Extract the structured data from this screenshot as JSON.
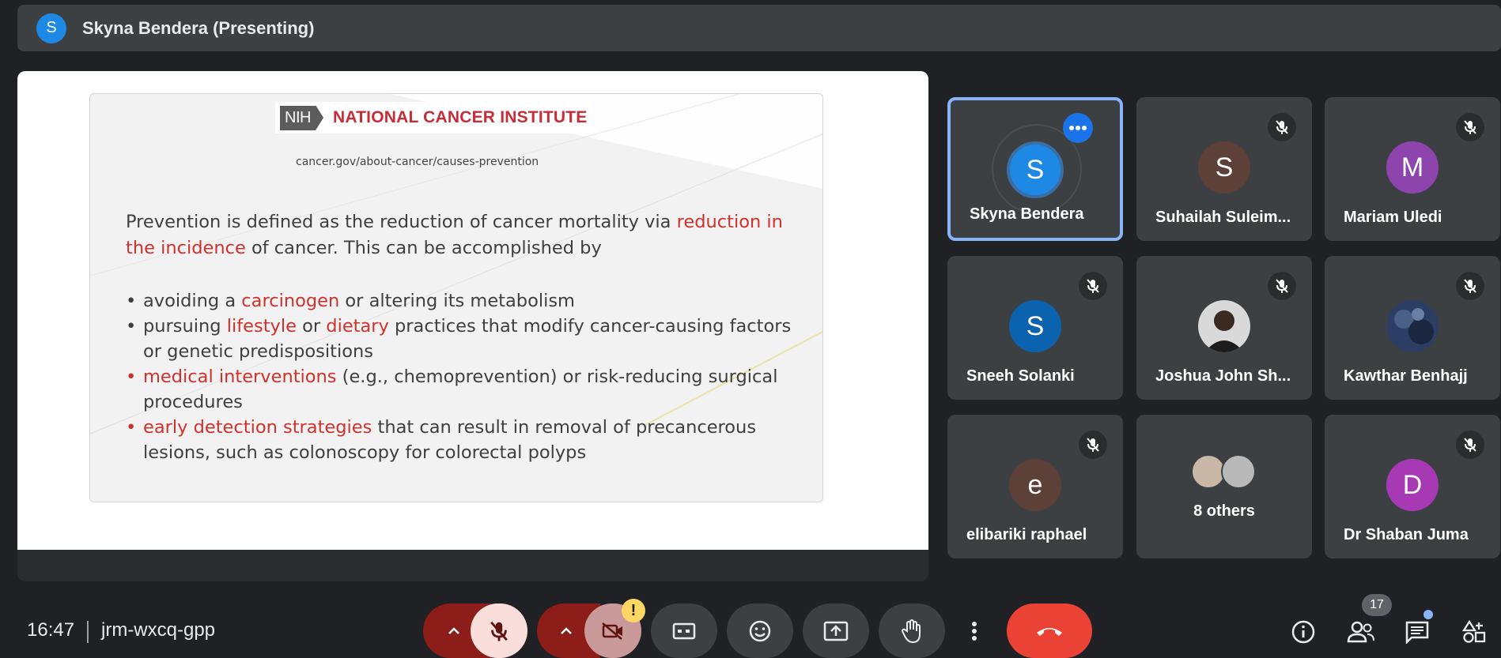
{
  "presenter_bar": {
    "avatar_letter": "S",
    "label": "Skyna Bendera (Presenting)"
  },
  "slide": {
    "logo_box": "NIH",
    "logo_title": "NATIONAL CANCER INSTITUTE",
    "url": "cancer.gov/about-cancer/causes-prevention",
    "para_1": "Prevention is defined as the reduction of cancer mortality via ",
    "para_red": "reduction in the incidence",
    "para_2": " of cancer. This can be accomplished by",
    "b1_a": "avoiding a ",
    "b1_red": "carcinogen",
    "b1_b": " or altering its metabolism",
    "b2_a": "pursuing ",
    "b2_red1": "lifestyle",
    "b2_b": " or ",
    "b2_red2": "dietary",
    "b2_c": " practices that modify cancer-causing factors or genetic predispositions",
    "b3_red": "medical interventions",
    "b3_b": " (e.g., chemoprevention) or risk-reducing surgical procedures",
    "b4_red": "early detection strategies",
    "b4_b": " that can result in removal of precancerous lesions, such as colonoscopy for colorectal polyps",
    "bullet": "•"
  },
  "participants": [
    {
      "name": "Skyna Bendera",
      "letter": "S",
      "color": "#1e88e5"
    },
    {
      "name": "Suhailah Suleim...",
      "letter": "S",
      "color": "#5d4037"
    },
    {
      "name": "Mariam Uledi",
      "letter": "M",
      "color": "#8e44ad"
    },
    {
      "name": "Sneeh Solanki",
      "letter": "S",
      "color": "#0b63b0"
    },
    {
      "name": "Joshua John Sh...",
      "letter": "",
      "color": "#d9d9d9"
    },
    {
      "name": "Kawthar Benhajj",
      "letter": "",
      "color": "#2c3e63"
    },
    {
      "name": "elibariki raphael",
      "letter": "e",
      "color": "#5d4037"
    },
    {
      "name": "8 others",
      "letter": "",
      "color": "#999999"
    },
    {
      "name": "Dr Shaban Juma",
      "letter": "D",
      "color": "#a73ab4"
    }
  ],
  "bottom": {
    "time": "16:47",
    "meeting_code": "jrm-wxcq-gpp",
    "warning": "!",
    "people_count": "17"
  }
}
